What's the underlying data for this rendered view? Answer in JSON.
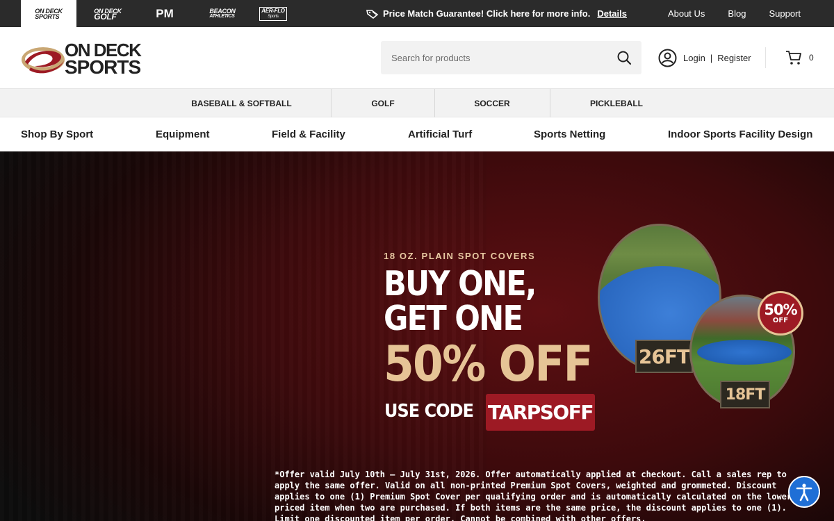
{
  "topbar": {
    "brands": [
      {
        "line1": "ON DECK",
        "line2": "SPORTS",
        "active": true
      },
      {
        "line1": "ON DECK",
        "line2": "GOLF",
        "active": false
      },
      {
        "line1": "PM",
        "line2": "",
        "active": false
      },
      {
        "line1": "BEACON",
        "line2": "ATHLETICS",
        "active": false
      },
      {
        "line1": "AER-FLO",
        "line2": "Sports",
        "active": false
      }
    ],
    "promo_text": "Price Match Guarantee! Click here for more info.",
    "promo_link": "Details",
    "links": [
      "About Us",
      "Blog",
      "Support"
    ]
  },
  "header": {
    "logo_line1": "ON DECK",
    "logo_line2": "SPORTS",
    "search_placeholder": "Search for products",
    "login": "Login",
    "separator": "|",
    "register": "Register",
    "cart_count": "0"
  },
  "sport_tabs": [
    "BASEBALL & SOFTBALL",
    "GOLF",
    "SOCCER",
    "PICKLEBALL"
  ],
  "main_nav": [
    "Shop By Sport",
    "Equipment",
    "Field & Facility",
    "Artificial Turf",
    "Sports Netting",
    "Indoor Sports Facility Design"
  ],
  "hero": {
    "subheading": "18 OZ. PLAIN SPOT COVERS",
    "line1": "BUY ONE,",
    "line2": "GET ONE",
    "discount": "50% OFF",
    "code_label": "USE CODE",
    "code": "TARPSOFF",
    "size_large": "26FT",
    "size_small": "18FT",
    "badge_pct": "50%",
    "badge_off": "OFF",
    "disclaimer": "*Offer valid July 10th – July 31st, 2026. Offer automatically applied at checkout. Call a sales rep to apply the same offer. Valid on all non-printed Premium Spot Covers, weighted and grommeted. Discount applies to one (1) Premium Spot Cover per qualifying order and is automatically calculated on the lower-priced item when two are purchased. If both items are the same price, the discount applies to one (1). Limit one discounted item per order. Cannot be combined with other offers."
  },
  "colors": {
    "topbar_bg": "#2b2b2b",
    "brand_red": "#9d1a24",
    "gold": "#e6c496",
    "accessibility_blue": "#1f6fd6"
  },
  "icons": {
    "promo": "price-tag-icon",
    "search": "search-icon",
    "account": "user-icon",
    "cart": "cart-icon",
    "accessibility": "accessibility-icon"
  }
}
